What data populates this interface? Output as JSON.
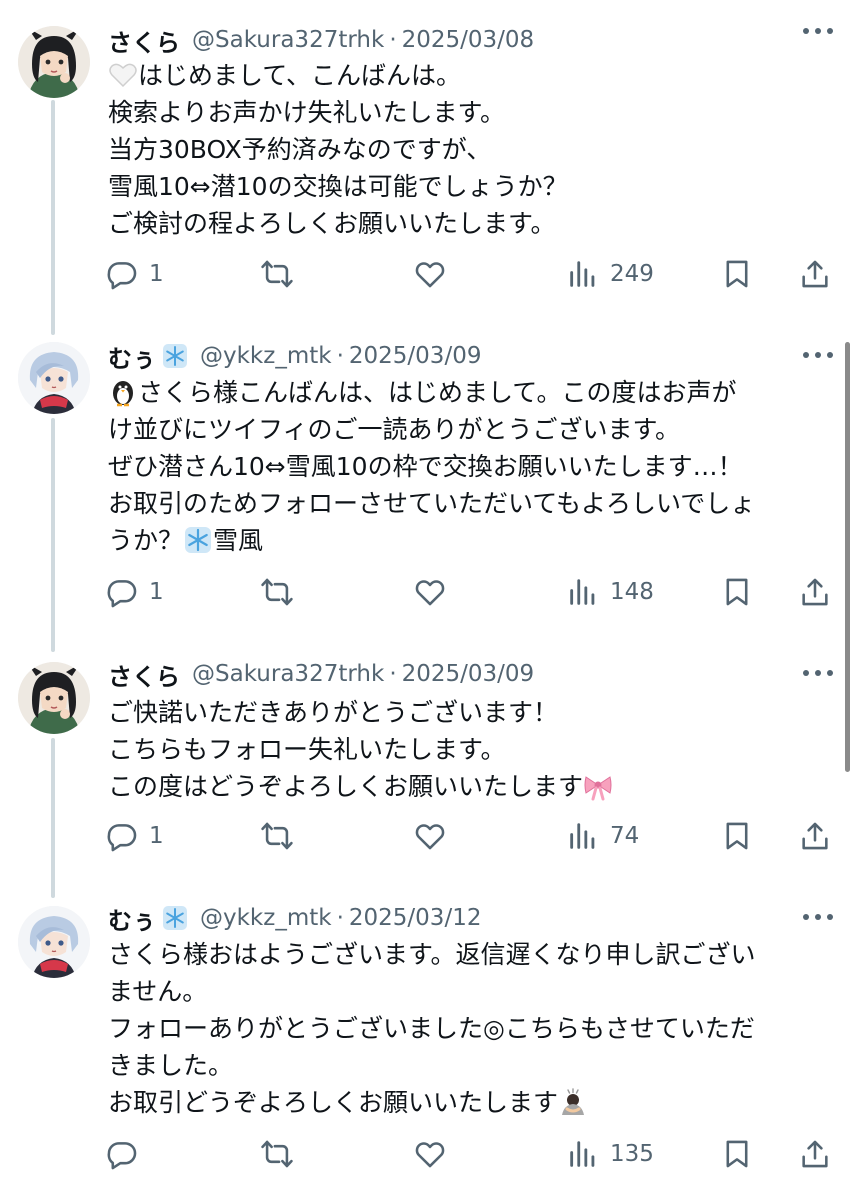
{
  "tweets": [
    {
      "name": "さくら",
      "name_emoji": "",
      "handle": "@Sakura327trhk",
      "separator": "·",
      "date": "2025/03/08",
      "lead_icon": "white-heart",
      "lines": [
        "はじめまして、こんばんは。",
        "検索よりお声かけ失礼いたします。",
        "当方30BOX予約済みなのですが、",
        "雪風10⇔潜10の交換は可能でしょうか？",
        "ご検討の程よろしくお願いいたします。"
      ],
      "replies": "1",
      "views": "249"
    },
    {
      "name": "むぅ",
      "name_emoji": "snowflake",
      "handle": "@ykkz_mtk",
      "separator": "·",
      "date": "2025/03/09",
      "lead_icon": "penguin",
      "lines": [
        "さくら様こんばんは、はじめまして。この度はお声が",
        "け並びにツイフィのご一読ありがとうございます。",
        "ぜひ潜さん10⇔雪風10の枠で交換お願いいたします…！",
        "お取引のためフォローさせていただいてもよろしいでしょ",
        "うか？",
        "雪風"
      ],
      "replies": "1",
      "views": "148"
    },
    {
      "name": "さくら",
      "name_emoji": "",
      "handle": "@Sakura327trhk",
      "separator": "·",
      "date": "2025/03/09",
      "lines": [
        "ご快諾いただきありがとうございます！",
        "こちらもフォロー失礼いたします。",
        "この度はどうぞよろしくお願いいたします"
      ],
      "trail_icon": "ribbon",
      "replies": "1",
      "views": "74"
    },
    {
      "name": "むぅ",
      "name_emoji": "snowflake",
      "handle": "@ykkz_mtk",
      "separator": "·",
      "date": "2025/03/12",
      "lines": [
        "さくら様おはようございます。返信遅くなり申し訳ござい",
        "ません。",
        "フォローありがとうございました◎こちらもさせていただ",
        "きました。",
        "お取引どうぞよろしくお願いいたします"
      ],
      "trail_icon": "person-bowing",
      "replies": "",
      "views": "135"
    }
  ],
  "icons": {
    "reply": "reply-icon",
    "retweet": "retweet-icon",
    "like": "heart-icon",
    "views": "views-icon",
    "bookmark": "bookmark-icon",
    "share": "share-icon",
    "more": "more-icon"
  },
  "colors": {
    "text": "#0f1419",
    "secondary": "#536471",
    "thread_line": "#cfd9de"
  }
}
